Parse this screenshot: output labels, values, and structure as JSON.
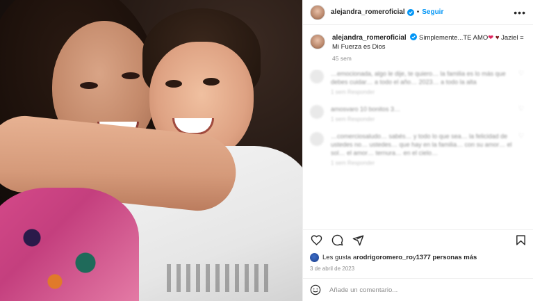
{
  "post": {
    "photo_alt": "Foto de la publicación",
    "header": {
      "username": "alejandra_romeroficial",
      "separator": "•",
      "follow_label": "Seguir",
      "more_label": "•••"
    },
    "caption": {
      "username": "alejandra_romeroficial",
      "text": "Simplemente...TE AMO",
      "text_after_emojis": " Jaziel = Mi Fuerza es Dios",
      "heart_red": "❤",
      "heart_dark": "♥",
      "time_ago": "45 sem"
    },
    "comments_blurred": [
      {
        "text": "…emocionada, algo le dije, te quiero… la familia es lo más que debes cuidar… a todo el año… 2023… a todo la alta",
        "meta": "1 sem   Responder"
      },
      {
        "text": "amosvaro 10 bonitos 3…",
        "meta": "1 sem   Responder"
      },
      {
        "text": "…comerciosaludo… sabés… y todo lo que sea… la felicidad de ustedes no… ustedes… que hay en la familia… con su amor… el sol… el amor… ternura… en el cielo…",
        "meta": "1 sem   Responder"
      }
    ],
    "likes": {
      "prefix": "Les gusta a ",
      "user": "rodrigoromero_ro",
      "suffix": " y ",
      "count_text": "1377 personas más"
    },
    "date": "3 de abril de 2023",
    "comment_input": {
      "placeholder": "Añade un comentario..."
    },
    "icons": {
      "like": "heart-outline-icon",
      "comment": "speech-bubble-icon",
      "share": "paper-plane-icon",
      "save": "bookmark-icon",
      "emoji": "smiley-icon",
      "verified": "verified-badge-icon"
    },
    "colors": {
      "accent": "#0095f6",
      "text": "#262626",
      "muted": "#8e8e8e",
      "verified": "#0095f6"
    }
  }
}
